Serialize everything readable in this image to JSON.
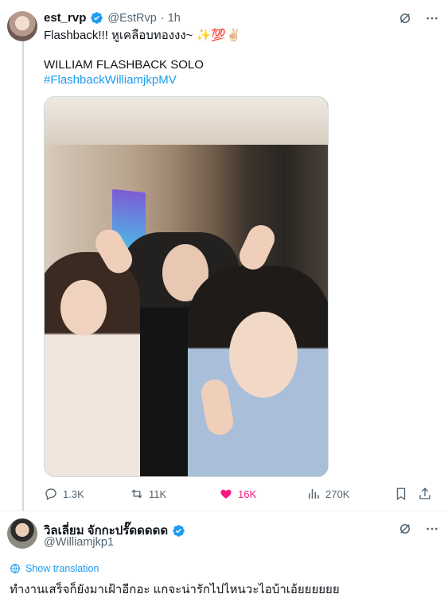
{
  "post": {
    "author_name": "est_rvp",
    "author_handle": "@EstRvp",
    "time": "· 1h",
    "line1": "Flashback!!! หูเคลือบทองงง~ ✨💯✌🏻",
    "line2": "WILLIAM FLASHBACK SOLO",
    "hashtag": "#FlashbackWilliamjkpMV",
    "stats": {
      "replies": "1.3K",
      "reposts": "11K",
      "likes": "16K",
      "views": "270K"
    }
  },
  "reply": {
    "author_name": "วิลเลี่ยม จักกะปรั๊ดดดดด",
    "author_handle": "@Williamjkp1",
    "translation_label": "Show translation",
    "text": "ทำงานเสร็จก็ยังมาเฝ้าอีกอะ แกจะน่ารักไปไหนวะไอบ้าเอ้ยยยยยย"
  },
  "colors": {
    "accent": "#1d9bf0",
    "like": "#f91880",
    "muted": "#536471"
  }
}
